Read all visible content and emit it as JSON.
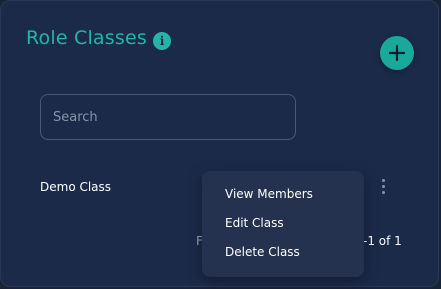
{
  "header": {
    "title": "Role Classes",
    "info_glyph": "i"
  },
  "search": {
    "placeholder": "Search",
    "value": ""
  },
  "rows": [
    {
      "label": "Demo Class"
    }
  ],
  "pagination": {
    "prefix": "F",
    "range": "-1 of 1"
  },
  "menu": {
    "items": [
      {
        "label": "View Members"
      },
      {
        "label": "Edit Class"
      },
      {
        "label": "Delete Class"
      }
    ]
  },
  "colors": {
    "accent": "#23b5a6",
    "panel": "#1c2a4a",
    "menu": "#24324f"
  },
  "icons": {
    "info": "info-icon",
    "add": "plus-icon",
    "row_actions": "kebab-menu-icon"
  }
}
